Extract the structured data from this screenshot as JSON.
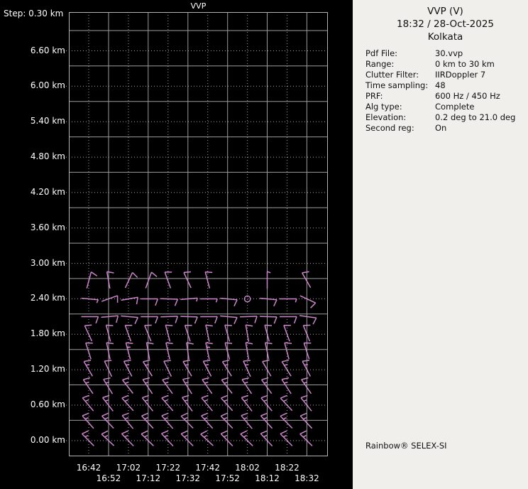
{
  "colors": {
    "bg": "#000000",
    "panel_bg": "#f0efec",
    "plot_text": "#ffffff",
    "panel_text": "#111111",
    "grid_solid": "#9c9c9c",
    "grid_dotted": "#a8a8a8",
    "plot_border": "#b4b4b4",
    "barb": "#cd86cd"
  },
  "plot": {
    "title": "VVP",
    "step_label": "Step: 0.30 km",
    "altitude_labels": [
      "6.60 km",
      "6.00 km",
      "5.40 km",
      "4.80 km",
      "4.20 km",
      "3.60 km",
      "3.00 km",
      "2.40 km",
      "1.80 km",
      "1.20 km",
      "0.60 km",
      "0.00 km"
    ],
    "time_labels_row1": [
      "16:42",
      "17:02",
      "17:22",
      "17:42",
      "18:02",
      "18:22"
    ],
    "time_labels_row2": [
      "16:52",
      "17:12",
      "17:32",
      "17:52",
      "18:12",
      "18:32"
    ]
  },
  "chart_data": {
    "type": "wind-barb-time-height",
    "title": "VVP",
    "x_times": [
      "16:42",
      "16:52",
      "17:02",
      "17:12",
      "17:22",
      "17:32",
      "17:42",
      "17:52",
      "18:02",
      "18:12",
      "18:22",
      "18:32"
    ],
    "altitude_axis": {
      "min_km": 0.0,
      "max_km": 6.6,
      "step_km": 0.3,
      "labeled_every_km": 0.6
    },
    "legend": "wind barbs: dir_deg = direction wind blows from (met convention), speed_kt in knots; 'calm' = open circle",
    "barbs": [
      {
        "alt_km": 2.7,
        "cells": [
          {
            "d": 15,
            "s": 10
          },
          {
            "d": 350,
            "s": 10
          },
          {
            "d": 25,
            "s": 10
          },
          {
            "d": 20,
            "s": 10
          },
          {
            "d": 340,
            "s": 10
          },
          {
            "d": 335,
            "s": 10
          },
          {
            "d": 345,
            "s": 10
          },
          null,
          null,
          {
            "d": 0,
            "s": 5
          },
          null,
          {
            "d": 330,
            "s": 10
          }
        ]
      },
      {
        "alt_km": 2.4,
        "cells": [
          {
            "d": 95,
            "s": 5
          },
          {
            "d": 70,
            "s": 10
          },
          {
            "d": 80,
            "s": 10
          },
          {
            "d": 90,
            "s": 10
          },
          {
            "d": 92,
            "s": 10
          },
          {
            "d": 85,
            "s": 5
          },
          {
            "d": 90,
            "s": 5
          },
          {
            "d": 95,
            "s": 10
          },
          "calm",
          {
            "d": 95,
            "s": 10
          },
          {
            "d": 90,
            "s": 5
          },
          {
            "d": 115,
            "s": 10
          }
        ]
      },
      {
        "alt_km": 2.1,
        "cells": [
          {
            "d": 90,
            "s": 10
          },
          {
            "d": 85,
            "s": 10
          },
          {
            "d": 95,
            "s": 10
          },
          {
            "d": 90,
            "s": 10
          },
          {
            "d": 88,
            "s": 10
          },
          {
            "d": 92,
            "s": 10
          },
          {
            "d": 90,
            "s": 10
          },
          {
            "d": 95,
            "s": 10
          },
          {
            "d": 88,
            "s": 10
          },
          {
            "d": 92,
            "s": 10
          },
          {
            "d": 90,
            "s": 10
          },
          {
            "d": 98,
            "s": 10
          }
        ]
      },
      {
        "alt_km": 1.8,
        "cells": [
          {
            "d": 335,
            "s": 10
          },
          {
            "d": 345,
            "s": 10
          },
          {
            "d": 340,
            "s": 10
          },
          {
            "d": 338,
            "s": 10
          },
          {
            "d": 345,
            "s": 10
          },
          {
            "d": 342,
            "s": 10
          },
          {
            "d": 348,
            "s": 10
          },
          {
            "d": 344,
            "s": 10
          },
          {
            "d": 350,
            "s": 10
          },
          {
            "d": 345,
            "s": 10
          },
          {
            "d": 340,
            "s": 10
          },
          {
            "d": 338,
            "s": 10
          }
        ]
      },
      {
        "alt_km": 1.5,
        "cells": [
          {
            "d": 342,
            "s": 10
          },
          {
            "d": 348,
            "s": 10
          },
          {
            "d": 345,
            "s": 15
          },
          {
            "d": 350,
            "s": 10
          },
          {
            "d": 347,
            "s": 10
          },
          {
            "d": 352,
            "s": 10
          },
          {
            "d": 348,
            "s": 15
          },
          {
            "d": 345,
            "s": 10
          },
          {
            "d": 350,
            "s": 10
          },
          {
            "d": 348,
            "s": 10
          },
          {
            "d": 345,
            "s": 10
          },
          {
            "d": 342,
            "s": 10
          }
        ]
      },
      {
        "alt_km": 1.2,
        "cells": [
          {
            "d": 330,
            "s": 15
          },
          {
            "d": 335,
            "s": 10
          },
          {
            "d": 332,
            "s": 15
          },
          {
            "d": 328,
            "s": 15
          },
          {
            "d": 334,
            "s": 10
          },
          {
            "d": 330,
            "s": 15
          },
          {
            "d": 332,
            "s": 15
          },
          {
            "d": 328,
            "s": 15
          },
          {
            "d": 335,
            "s": 15
          },
          {
            "d": 330,
            "s": 10
          },
          {
            "d": 328,
            "s": 15
          },
          {
            "d": 332,
            "s": 15
          }
        ]
      },
      {
        "alt_km": 0.9,
        "cells": [
          {
            "d": 325,
            "s": 15
          },
          {
            "d": 328,
            "s": 15
          },
          {
            "d": 322,
            "s": 15
          },
          {
            "d": 326,
            "s": 15
          },
          {
            "d": 324,
            "s": 15
          },
          {
            "d": 328,
            "s": 15
          },
          {
            "d": 325,
            "s": 15
          },
          {
            "d": 322,
            "s": 15
          },
          {
            "d": 326,
            "s": 15
          },
          {
            "d": 324,
            "s": 15
          },
          {
            "d": 327,
            "s": 15
          },
          {
            "d": 325,
            "s": 15
          }
        ]
      },
      {
        "alt_km": 0.6,
        "cells": [
          {
            "d": 320,
            "s": 15
          },
          {
            "d": 322,
            "s": 15
          },
          {
            "d": 318,
            "s": 15
          },
          {
            "d": 321,
            "s": 15
          },
          {
            "d": 319,
            "s": 15
          },
          {
            "d": 323,
            "s": 15
          },
          {
            "d": 320,
            "s": 15
          },
          {
            "d": 318,
            "s": 15
          },
          {
            "d": 322,
            "s": 15
          },
          {
            "d": 320,
            "s": 15
          },
          {
            "d": 317,
            "s": 15
          },
          {
            "d": 321,
            "s": 15
          }
        ]
      },
      {
        "alt_km": 0.3,
        "cells": [
          {
            "d": 318,
            "s": 15
          },
          {
            "d": 316,
            "s": 15
          },
          {
            "d": 320,
            "s": 15
          },
          {
            "d": 317,
            "s": 15
          },
          {
            "d": 319,
            "s": 15
          },
          {
            "d": 315,
            "s": 15
          },
          {
            "d": 318,
            "s": 15
          },
          {
            "d": 316,
            "s": 15
          },
          {
            "d": 320,
            "s": 15
          },
          {
            "d": 318,
            "s": 15
          },
          {
            "d": 315,
            "s": 15
          },
          {
            "d": 317,
            "s": 15
          }
        ]
      },
      {
        "alt_km": 0.0,
        "cells": [
          {
            "d": 315,
            "s": 15
          },
          {
            "d": 313,
            "s": 15
          },
          {
            "d": 316,
            "s": 15
          },
          {
            "d": 314,
            "s": 15
          },
          {
            "d": 317,
            "s": 15
          },
          {
            "d": 315,
            "s": 15
          },
          {
            "d": 313,
            "s": 15
          },
          {
            "d": 316,
            "s": 15
          },
          {
            "d": 314,
            "s": 15
          },
          {
            "d": 317,
            "s": 15
          },
          {
            "d": 315,
            "s": 15
          },
          {
            "d": 314,
            "s": 15
          }
        ]
      }
    ]
  },
  "panel": {
    "title": "VVP (V)",
    "datetime": "18:32 / 28-Oct-2025",
    "site": "Kolkata",
    "params": [
      {
        "label": "Pdf File:",
        "value": "30.vvp"
      },
      {
        "label": "Range:",
        "value": "0 km to 30 km"
      },
      {
        "label": "Clutter Filter:",
        "value": "IIRDoppler 7"
      },
      {
        "label": "Time sampling:",
        "value": "48"
      },
      {
        "label": "PRF:",
        "value": "600 Hz / 450 Hz"
      },
      {
        "label": "Alg type:",
        "value": "Complete"
      },
      {
        "label": "Elevation:",
        "value": "0.2 deg to 21.0 deg"
      },
      {
        "label": "Second reg:",
        "value": "On"
      }
    ],
    "footer": "Rainbow® SELEX-SI"
  }
}
